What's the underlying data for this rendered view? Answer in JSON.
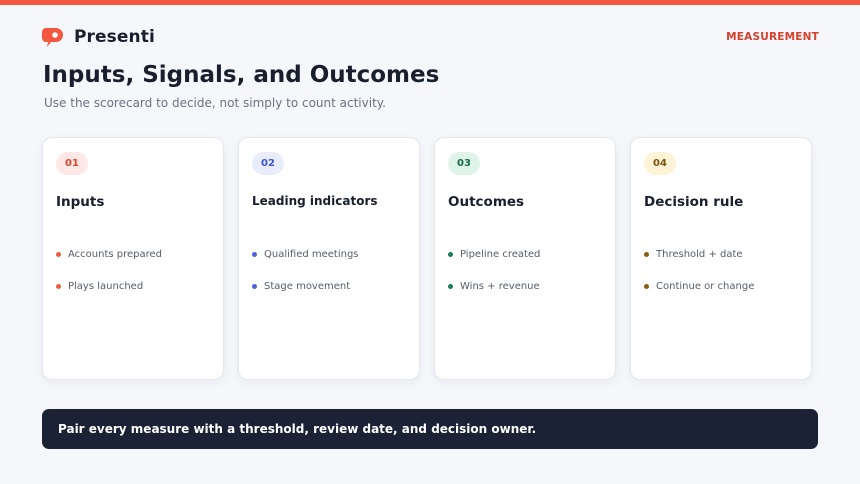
{
  "brand": {
    "name": "Presenti",
    "accent": "#f4573f"
  },
  "section_tag": "MEASUREMENT",
  "title": "Inputs, Signals, and Outcomes",
  "subtitle": "Use the scorecard to decide, not simply to count activity.",
  "cards": [
    {
      "number": "01",
      "title": "Inputs",
      "badge_bg": "#fde8e5",
      "badge_fg": "#e0452f",
      "dot_color": "#ef5a40",
      "items": [
        "Accounts prepared",
        "Plays launched"
      ]
    },
    {
      "number": "02",
      "title": "Leading indicators",
      "badge_bg": "#e8ecfb",
      "badge_fg": "#3d55c7",
      "dot_color": "#4a62d4",
      "items": [
        "Qualified meetings",
        "Stage movement"
      ]
    },
    {
      "number": "03",
      "title": "Outcomes",
      "badge_bg": "#def4ea",
      "badge_fg": "#166b4a",
      "dot_color": "#1d7a52",
      "items": [
        "Pipeline created",
        "Wins + revenue"
      ]
    },
    {
      "number": "04",
      "title": "Decision rule",
      "badge_bg": "#fdf3d6",
      "badge_fg": "#7a5410",
      "dot_color": "#8a5e12",
      "items": [
        "Threshold + date",
        "Continue or change"
      ]
    }
  ],
  "banner": {
    "text": "Pair every measure with a threshold, review date, and decision owner."
  }
}
